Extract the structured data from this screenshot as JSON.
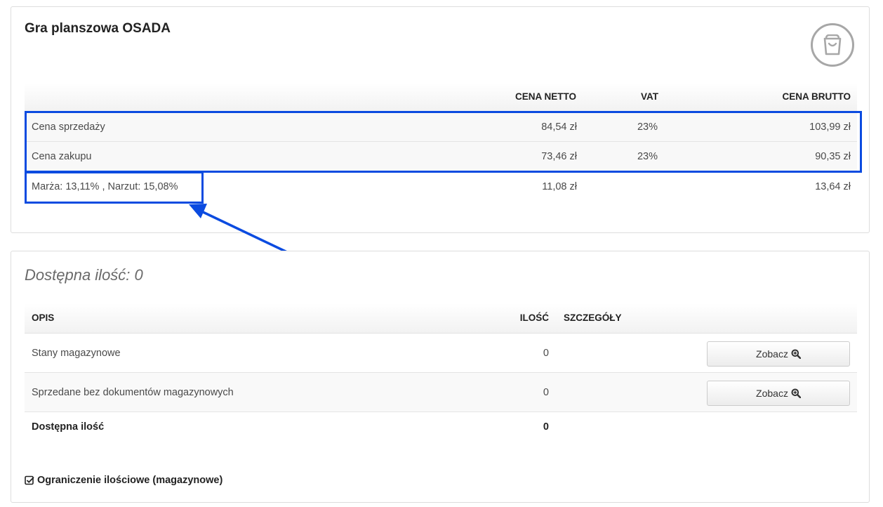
{
  "product": {
    "title": "Gra planszowa OSADA",
    "icon": "shopping-bag-icon"
  },
  "price_table": {
    "headers": {
      "net": "CENA NETTO",
      "vat": "VAT",
      "gross": "CENA BRUTTO"
    },
    "rows": [
      {
        "label": "Cena sprzedaży",
        "net": "84,54 zł",
        "vat": "23%",
        "gross": "103,99 zł"
      },
      {
        "label": "Cena zakupu",
        "net": "73,46 zł",
        "vat": "23%",
        "gross": "90,35 zł"
      },
      {
        "label": "Marża: 13,11% , Narzut: 15,08%",
        "net": "11,08 zł",
        "vat": "",
        "gross": "13,64 zł"
      }
    ]
  },
  "stock": {
    "title": "Dostępna ilość: 0",
    "headers": {
      "description": "OPIS",
      "quantity": "ILOŚĆ",
      "details": "SZCZEGÓŁY"
    },
    "rows": [
      {
        "description": "Stany magazynowe",
        "quantity": "0",
        "button": "Zobacz"
      },
      {
        "description": "Sprzedane bez dokumentów magazynowych",
        "quantity": "0",
        "button": "Zobacz"
      }
    ],
    "total": {
      "label": "Dostępna ilość",
      "quantity": "0"
    },
    "limit_label": "Ograniczenie ilościowe (magazynowe)"
  },
  "colors": {
    "annotation": "#0b4be0",
    "panel_border": "#dddddd"
  }
}
